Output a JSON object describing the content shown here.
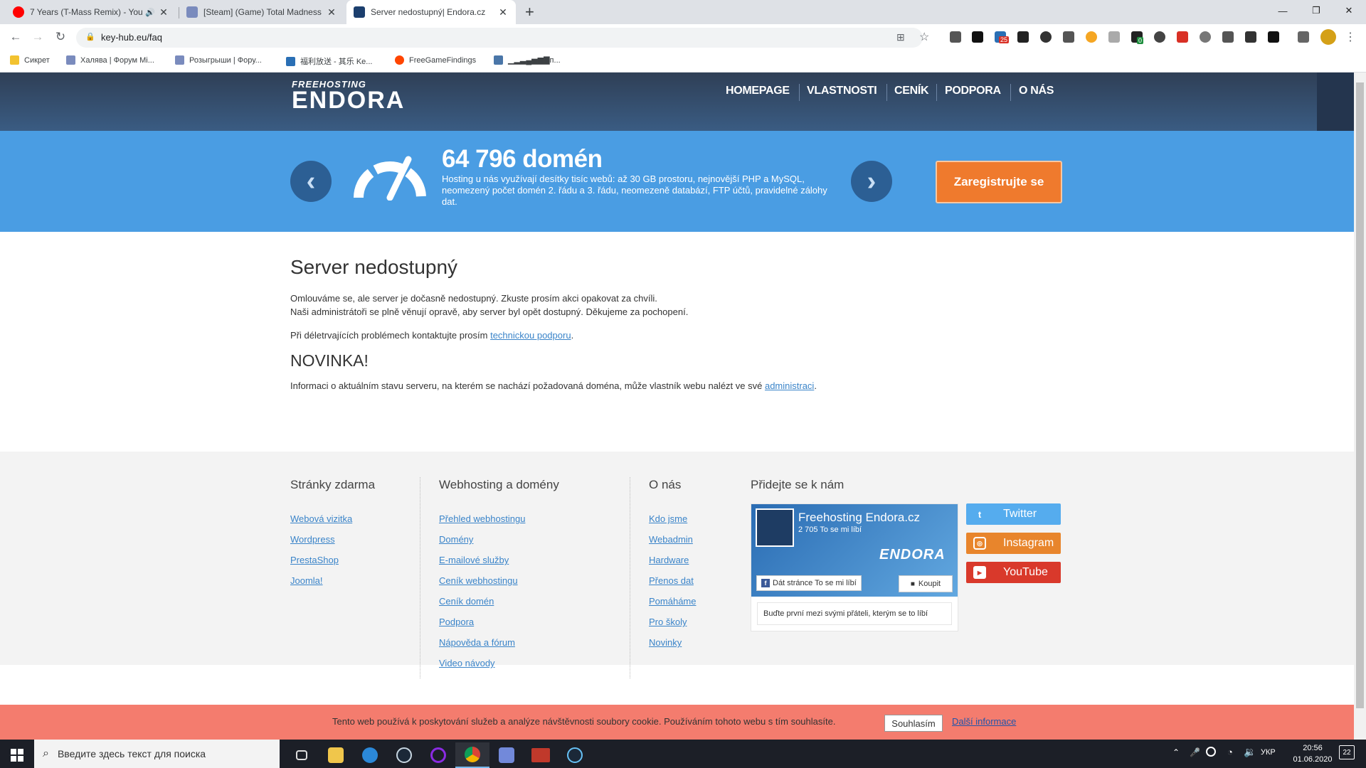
{
  "browser": {
    "tabs": [
      {
        "title": "7 Years (T-Mass Remix) - You",
        "icon": "youtube-icon",
        "audio": "speaker-icon"
      },
      {
        "title": "[Steam] (Game) Total Madness | ",
        "icon": "forum-icon"
      },
      {
        "title": "Server nedostupný| Endora.cz",
        "icon": "endora-icon"
      }
    ],
    "new_tab": "+",
    "url": "key-hub.eu/faq",
    "bookmarks": [
      {
        "label": "Сикрет",
        "icon": "folder-icon",
        "color": "#f2c230"
      },
      {
        "label": "Халява | Форум Mi...",
        "icon": "forum-icon",
        "color": "#7a8bbd"
      },
      {
        "label": "Розыгрыши | Фору...",
        "icon": "forum-icon",
        "color": "#7a8bbd"
      },
      {
        "label": "福利放送 - 其乐 Ke...",
        "icon": "keylol-icon",
        "color": "#2a6fb5"
      },
      {
        "label": "FreeGameFindings",
        "icon": "reddit-icon",
        "color": "#ff4500"
      },
      {
        "label": "▁▂▃▄▅▆▇п...",
        "icon": "vk-icon",
        "color": "#4a76a8"
      }
    ],
    "extension_badge_1": "25",
    "extension_badge_2": "0"
  },
  "site": {
    "logo_top": "FREEHOSTING",
    "logo_main": "ENDORA",
    "nav": [
      "HOMEPAGE",
      "VLASTNOSTI",
      "CENÍK",
      "PODPORA",
      "O NÁS"
    ],
    "hero": {
      "headline": "64 796 domén",
      "text": "Hosting u nás využívají desítky tisíc webů: až 30 GB prostoru, nejnovější PHP a MySQL, neomezený počet domén 2. řádu a 3. řádu, neomezeně databází, FTP účtů, pravidelné zálohy dat.",
      "prev": "‹",
      "next": "›",
      "cta": "Zaregistrujte se"
    },
    "main": {
      "title": "Server nedostupný",
      "p1": "Omlouváme se, ale server je dočasně nedostupný. Zkuste prosím akci opakovat za chvíli.",
      "p2": "Naši administrátoři se plně věnují opravě, aby server byl opět dostupný. Děkujeme za pochopení.",
      "p3_text": "Při déletrvajících problémech kontaktujte prosím ",
      "p3_link": "technickou podporu",
      "p3_end": ".",
      "news_title": "NOVINKA!",
      "p4_text": "Informaci o aktuálním stavu serveru, na kterém se nachází požadovaná doména, může vlastník webu nalézt ve své ",
      "p4_link": "administraci",
      "p4_end": "."
    },
    "footer": {
      "col1": {
        "title": "Stránky zdarma",
        "links": [
          "Webová vizitka",
          "Wordpress",
          "PrestaShop",
          "Joomla!"
        ]
      },
      "col2": {
        "title": "Webhosting a domény",
        "links": [
          "Přehled webhostingu",
          "Domény",
          "E-mailové služby",
          "Ceník webhostingu",
          "Ceník domén",
          "Podpora",
          "Nápověda a fórum",
          "Video návody"
        ]
      },
      "col3": {
        "title": "O nás",
        "links": [
          "Kdo jsme",
          "Webadmin",
          "Hardware",
          "Přenos dat",
          "Pomáháme",
          "Pro školy",
          "Novinky"
        ]
      },
      "col4": {
        "title": "Přidejte se k nám"
      },
      "fb": {
        "page_name": "Freehosting Endora.cz",
        "likes": "2 705 To se mi líbí",
        "like_btn": "Dát stránce To se mi líbí",
        "buy_btn": "Koupit",
        "friends_text": "Buďte první mezi svými přáteli, kterým se to líbí"
      },
      "social": [
        {
          "label": "Twitter",
          "icon": "twitter-icon",
          "color": "#55acee"
        },
        {
          "label": "Instagram",
          "icon": "instagram-icon",
          "color": "#e8852c"
        },
        {
          "label": "YouTube",
          "icon": "youtube-icon",
          "color": "#d9392b"
        }
      ]
    },
    "cookie": {
      "text": "Tento web používá k poskytování služeb a analýze návštěvnosti soubory cookie. Používáním tohoto webu s tím souhlasíte.",
      "agree": "Souhlasím",
      "more": "Další informace"
    }
  },
  "taskbar": {
    "search_placeholder": "Введите здесь текст для поиска",
    "lang": "УКР",
    "time": "20:56",
    "date": "01.06.2020",
    "notifications": "22"
  }
}
